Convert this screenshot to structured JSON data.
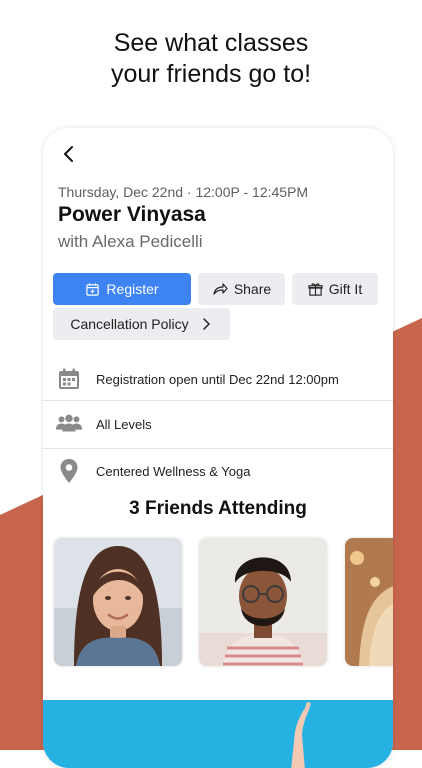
{
  "promo": {
    "headline_line1": "See what classes",
    "headline_line2": "your friends go to!"
  },
  "class": {
    "datetime": "Thursday, Dec 22nd · 12:00P - 12:45PM",
    "name": "Power Vinyasa",
    "instructor": "with Alexa Pedicelli"
  },
  "actions": {
    "register_label": "Register",
    "share_label": "Share",
    "gift_label": "Gift It",
    "policy_label": "Cancellation Policy"
  },
  "details": {
    "registration": "Registration open until Dec 22nd 12:00pm",
    "level": "All Levels",
    "location": "Centered Wellness & Yoga"
  },
  "friends": {
    "title": "3 Friends Attending",
    "count": 3
  },
  "icons": [
    "back-icon",
    "calendar-plus-icon",
    "share-arrow-icon",
    "gift-icon",
    "chevron-right-icon",
    "calendar-icon",
    "people-icon",
    "location-pin-icon"
  ],
  "colors": {
    "accent": "#3d84f2",
    "background_shape": "#c8654d"
  }
}
